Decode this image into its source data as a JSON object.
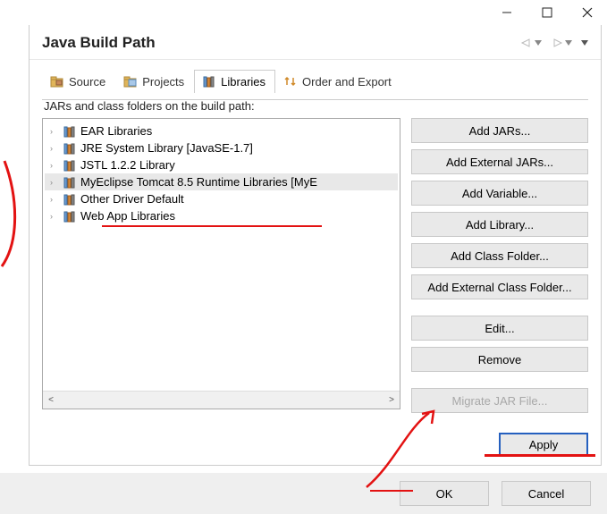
{
  "window": {
    "controls": {
      "minimize": "−",
      "maximize": "☐",
      "close": "✕"
    }
  },
  "header": {
    "title": "Java Build Path"
  },
  "tabs": {
    "source": "Source",
    "projects": "Projects",
    "libraries": "Libraries",
    "order": "Order and Export"
  },
  "subheading": "JARs and class folders on the build path:",
  "tree": {
    "items": [
      {
        "label": "EAR Libraries",
        "selected": false
      },
      {
        "label": "JRE System Library [JavaSE-1.7]",
        "selected": false
      },
      {
        "label": "JSTL 1.2.2 Library",
        "selected": false
      },
      {
        "label": "MyEclipse Tomcat 8.5 Runtime Libraries [MyE",
        "selected": true
      },
      {
        "label": "Other Driver Default",
        "selected": false
      },
      {
        "label": "Web App Libraries",
        "selected": false
      }
    ]
  },
  "buttons": {
    "add_jars": "Add JARs...",
    "add_ext_jars": "Add External JARs...",
    "add_variable": "Add Variable...",
    "add_library": "Add Library...",
    "add_class_folder": "Add Class Folder...",
    "add_ext_class_folder": "Add External Class Folder...",
    "edit": "Edit...",
    "remove": "Remove",
    "migrate": "Migrate JAR File..."
  },
  "apply_label": "Apply",
  "footer": {
    "ok": "OK",
    "cancel": "Cancel"
  }
}
